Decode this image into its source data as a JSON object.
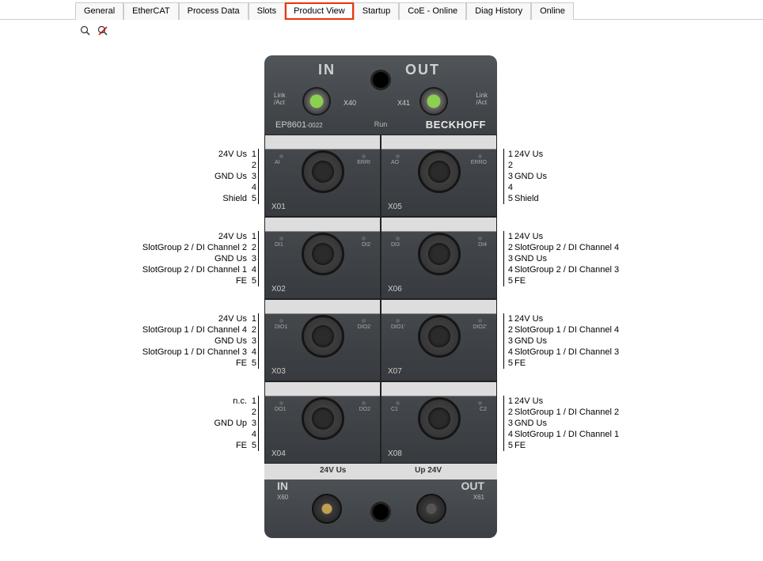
{
  "tabs": [
    "General",
    "EtherCAT",
    "Process Data",
    "Slots",
    "Product View",
    "Startup",
    "CoE - Online",
    "Diag History",
    "Online"
  ],
  "active_tab_index": 4,
  "device": {
    "header": {
      "in": "IN",
      "out": "OUT",
      "linkact": "Link\n/Act",
      "x40": "X40",
      "x41": "X41",
      "run": "Run",
      "model": "EP8601",
      "model_suffix": "-0022",
      "brand": "BECKHOFF"
    },
    "slots": [
      {
        "left": {
          "name": "X01",
          "led_l": "AI",
          "led_r": "ERRI"
        },
        "right": {
          "name": "X05",
          "led_l": "AO",
          "led_r": "ERRO"
        }
      },
      {
        "left": {
          "name": "X02",
          "led_l": "DI1",
          "led_r": "DI2"
        },
        "right": {
          "name": "X06",
          "led_l": "DI3",
          "led_r": "DI4"
        }
      },
      {
        "left": {
          "name": "X03",
          "led_l": "DIO1",
          "led_r": "DIO2"
        },
        "right": {
          "name": "X07",
          "led_l": "DIO1'",
          "led_r": "DIO2'"
        }
      },
      {
        "left": {
          "name": "X04",
          "led_l": "DO1",
          "led_r": "DO2"
        },
        "right": {
          "name": "X08",
          "led_l": "C1",
          "led_r": "C2"
        }
      }
    ],
    "footer": {
      "v24_us": "24V Us",
      "up24": "Up 24V",
      "in": "IN",
      "out": "OUT",
      "x60": "X60",
      "x61": "X61"
    }
  },
  "pinouts": {
    "left": [
      [
        {
          "n": "1",
          "t": "24V Us"
        },
        {
          "n": "2",
          "t": ""
        },
        {
          "n": "3",
          "t": "GND Us"
        },
        {
          "n": "4",
          "t": ""
        },
        {
          "n": "5",
          "t": "Shield"
        }
      ],
      [
        {
          "n": "1",
          "t": "24V Us"
        },
        {
          "n": "2",
          "t": "SlotGroup 2 / DI Channel 2"
        },
        {
          "n": "3",
          "t": "GND Us"
        },
        {
          "n": "4",
          "t": "SlotGroup 2 / DI Channel 1"
        },
        {
          "n": "5",
          "t": "FE"
        }
      ],
      [
        {
          "n": "1",
          "t": "24V Us"
        },
        {
          "n": "2",
          "t": "SlotGroup 1 / DI Channel 4"
        },
        {
          "n": "3",
          "t": "GND Us"
        },
        {
          "n": "4",
          "t": "SlotGroup 1 / DI Channel 3"
        },
        {
          "n": "5",
          "t": "FE"
        }
      ],
      [
        {
          "n": "1",
          "t": "n.c."
        },
        {
          "n": "2",
          "t": ""
        },
        {
          "n": "3",
          "t": "GND Up"
        },
        {
          "n": "4",
          "t": ""
        },
        {
          "n": "5",
          "t": "FE"
        }
      ]
    ],
    "right": [
      [
        {
          "n": "1",
          "t": "24V Us"
        },
        {
          "n": "2",
          "t": ""
        },
        {
          "n": "3",
          "t": "GND Us"
        },
        {
          "n": "4",
          "t": ""
        },
        {
          "n": "5",
          "t": "Shield"
        }
      ],
      [
        {
          "n": "1",
          "t": "24V Us"
        },
        {
          "n": "2",
          "t": "SlotGroup 2 / DI Channel 4"
        },
        {
          "n": "3",
          "t": "GND Us"
        },
        {
          "n": "4",
          "t": "SlotGroup 2 / DI Channel 3"
        },
        {
          "n": "5",
          "t": "FE"
        }
      ],
      [
        {
          "n": "1",
          "t": "24V Us"
        },
        {
          "n": "2",
          "t": "SlotGroup 1 / DI Channel 4"
        },
        {
          "n": "3",
          "t": "GND Us"
        },
        {
          "n": "4",
          "t": "SlotGroup 1 / DI Channel 3"
        },
        {
          "n": "5",
          "t": "FE"
        }
      ],
      [
        {
          "n": "1",
          "t": "24V Us"
        },
        {
          "n": "2",
          "t": "SlotGroup 1 / DI Channel 2"
        },
        {
          "n": "3",
          "t": "GND Us"
        },
        {
          "n": "4",
          "t": "SlotGroup 1 / DI Channel 1"
        },
        {
          "n": "5",
          "t": "FE"
        }
      ]
    ]
  }
}
